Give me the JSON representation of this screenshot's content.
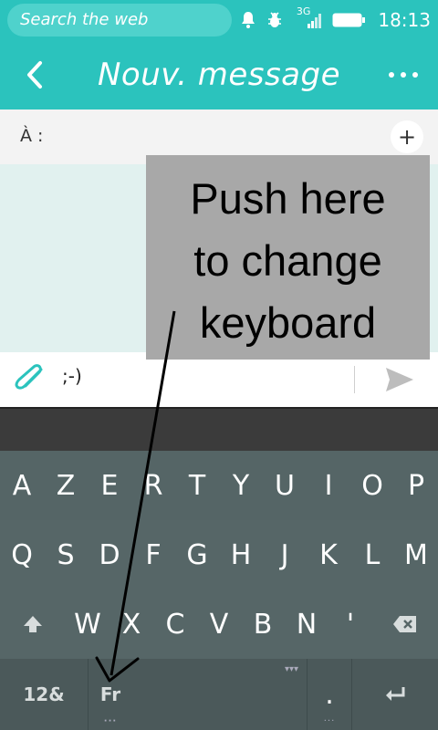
{
  "statusbar": {
    "search_placeholder": "Search the web",
    "network_label": "3G",
    "time": "18:13",
    "icons": [
      "bell-icon",
      "bug-icon",
      "signal-icon",
      "battery-icon"
    ]
  },
  "header": {
    "title": "Nouv. message",
    "back_icon": "chevron-left-icon",
    "menu_icon": "more-dots-icon"
  },
  "recipients": {
    "label": "À :",
    "add_label": "+"
  },
  "annotation": {
    "text": "Push here\nto change\nkeyboard"
  },
  "compose": {
    "message": ";-)",
    "attach_icon": "paperclip-icon",
    "send_icon": "send-icon"
  },
  "keyboard": {
    "row1": [
      "A",
      "Z",
      "E",
      "R",
      "T",
      "Y",
      "U",
      "I",
      "O",
      "P"
    ],
    "row2": [
      "Q",
      "S",
      "D",
      "F",
      "G",
      "H",
      "J",
      "K",
      "L",
      "M"
    ],
    "row3": [
      "W",
      "X",
      "C",
      "V",
      "B",
      "N",
      "'"
    ],
    "symbols_label": "12&",
    "language_label": "Fr",
    "period_label": ".",
    "shift_icon": "shift-icon",
    "backspace_icon": "backspace-icon",
    "enter_icon": "enter-icon"
  },
  "colors": {
    "accent": "#2bc3bd",
    "keyboard": "#566667",
    "annotation": "#a8a8a8"
  }
}
